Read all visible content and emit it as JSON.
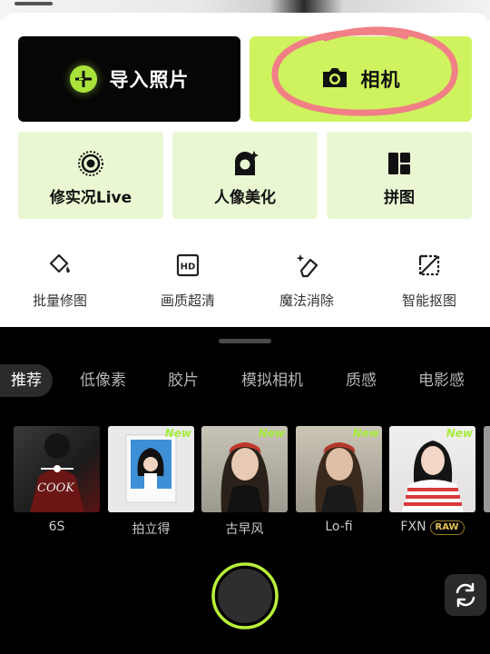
{
  "actions": {
    "import_label": "导入照片",
    "camera_label": "相机"
  },
  "feature_cards": [
    {
      "label": "修实况Live"
    },
    {
      "label": "人像美化"
    },
    {
      "label": "拼图"
    }
  ],
  "tools": [
    {
      "label": "批量修图"
    },
    {
      "label": "画质超清"
    },
    {
      "label": "魔法消除"
    },
    {
      "label": "智能抠图"
    }
  ],
  "filter_tabs": [
    {
      "label": "推荐",
      "active": true
    },
    {
      "label": "低像素"
    },
    {
      "label": "胶片"
    },
    {
      "label": "模拟相机"
    },
    {
      "label": "质感"
    },
    {
      "label": "电影感"
    }
  ],
  "filters": [
    {
      "label": "6S",
      "badge": ""
    },
    {
      "label": "拍立得",
      "badge": "New"
    },
    {
      "label": "古早风",
      "badge": "New"
    },
    {
      "label": "Lo-fi",
      "badge": "New"
    },
    {
      "label": "FXN",
      "badge": "New",
      "tag": "RAW"
    }
  ],
  "photo_text": "COOK",
  "hd_icon_text": "HD",
  "colors": {
    "accent_green": "#cff35e",
    "card_green": "#e9f8d2",
    "highlight_pink": "#f07f86",
    "dark_bg": "#000000",
    "new_badge": "#a6ec3a"
  }
}
